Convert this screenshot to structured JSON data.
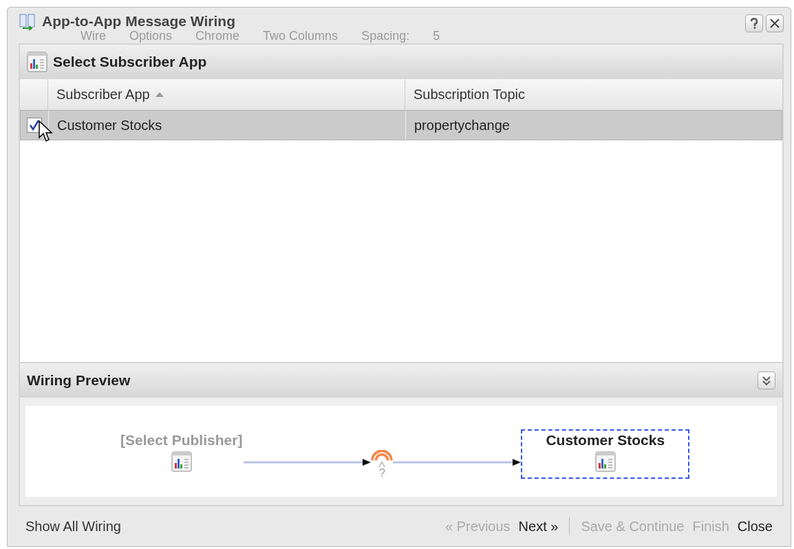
{
  "window": {
    "title": "App-to-App Message Wiring"
  },
  "background_toolbar": [
    "Wire",
    "Options",
    "Chrome",
    "Two Columns",
    "Spacing:",
    "5"
  ],
  "subscriber_panel": {
    "title": "Select Subscriber App",
    "table": {
      "columns": [
        {
          "label": "Subscriber App",
          "sorted": true
        },
        {
          "label": "Subscription Topic",
          "sorted": false
        }
      ],
      "rows": [
        {
          "checked": true,
          "selected": true,
          "cells": [
            "Customer Stocks",
            "propertychange"
          ]
        }
      ]
    }
  },
  "wiring_preview": {
    "title": "Wiring Preview",
    "channel_mark": "?",
    "publisher": {
      "label": "[Select Publisher]",
      "selected": false
    },
    "subscriber": {
      "label": "Customer Stocks",
      "selected": true
    }
  },
  "footer": {
    "link": "Show All Wiring",
    "nav_buttons": [
      {
        "label": "« Previous",
        "disabled": true
      },
      {
        "label": "Next »",
        "disabled": false
      }
    ],
    "action_buttons": [
      {
        "label": "Save & Continue",
        "disabled": true
      },
      {
        "label": "Finish",
        "disabled": true
      },
      {
        "label": "Close",
        "disabled": false
      }
    ]
  }
}
